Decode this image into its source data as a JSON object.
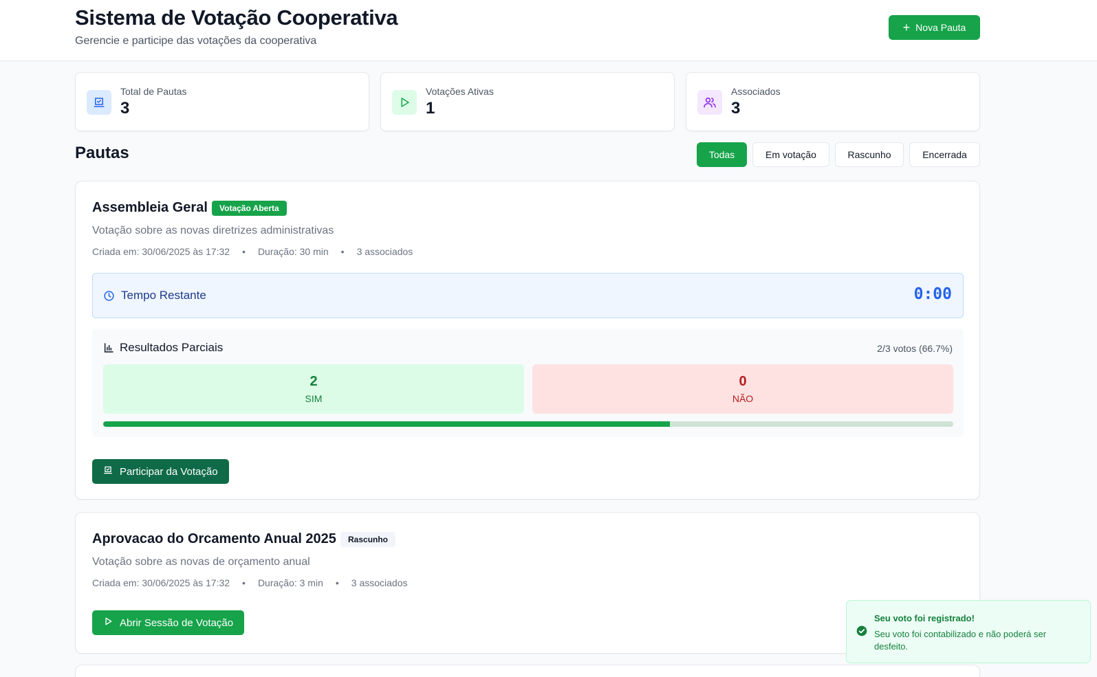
{
  "header": {
    "title": "Sistema de Votação Cooperativa",
    "subtitle": "Gerencie e participe das votações da cooperativa",
    "new_button": "Nova Pauta"
  },
  "stats": [
    {
      "label": "Total de Pautas",
      "value": "3",
      "icon": "vote-box-icon",
      "color": "#2563eb",
      "bg": "#dbeafe"
    },
    {
      "label": "Votações Ativas",
      "value": "1",
      "icon": "play-icon",
      "color": "#16a34a",
      "bg": "#dcfce7"
    },
    {
      "label": "Associados",
      "value": "3",
      "icon": "users-icon",
      "color": "#9333ea",
      "bg": "#f3e8ff"
    }
  ],
  "section": {
    "title": "Pautas",
    "filters": [
      "Todas",
      "Em votação",
      "Rascunho",
      "Encerrada"
    ],
    "active_filter": "Todas"
  },
  "pautas": [
    {
      "title": "Assembleia Geral",
      "badge": "Votação Aberta",
      "description": "Votação sobre as novas diretrizes administrativas",
      "created": "Criada em: 30/06/2025 às 17:32",
      "duration": "Duração: 30 min",
      "members": "3 associados",
      "timer_label": "Tempo Restante",
      "timer_value": "0:00",
      "results_label": "Resultados Parciais",
      "votes_count": "2/3 votos (66.7%)",
      "yes_count": "2",
      "yes_label": "SIM",
      "no_count": "0",
      "no_label": "NÃO",
      "progress_fraction": 0.667,
      "action": "Participar da Votação"
    },
    {
      "title": "Aprovacao do Orcamento Anual 2025",
      "badge": "Rascunho",
      "description": "Votação sobre as novas de orçamento anual",
      "created": "Criada em: 30/06/2025 às 17:32",
      "duration": "Duração: 3 min",
      "members": "3 associados",
      "action": "Abrir Sessão de Votação"
    }
  ],
  "toast": {
    "title": "Seu voto foi registrado!",
    "message": "Seu voto foi contabilizado e não poderá ser desfeito."
  },
  "colors": {
    "primary": "#16a34a",
    "primary_dark": "#0f6b47",
    "timer_blue": "#2563eb"
  }
}
